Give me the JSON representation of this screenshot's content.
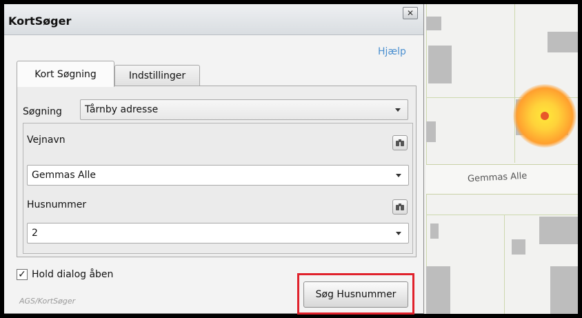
{
  "dialog": {
    "title": "KortSøger",
    "close_glyph": "✕",
    "help_link": "Hjælp",
    "tabs": [
      {
        "label": "Kort Søgning",
        "active": true
      },
      {
        "label": "Indstillinger",
        "active": false
      }
    ],
    "search_type": {
      "label": "Søgning",
      "selected": "Tårnby adresse"
    },
    "street": {
      "label": "Vejnavn",
      "selected": "Gemmas Alle"
    },
    "house_number": {
      "label": "Husnummer",
      "selected": "2"
    },
    "hold_dialog": {
      "label": "Hold dialog åben",
      "checked": true,
      "check_glyph": "✓"
    },
    "footer": "AGS/KortSøger",
    "search_button": "Søg Husnummer"
  },
  "map": {
    "road_label": "Gemmas Alle",
    "marker_color": "#e8582a",
    "highlight_color": "#e0212b"
  }
}
